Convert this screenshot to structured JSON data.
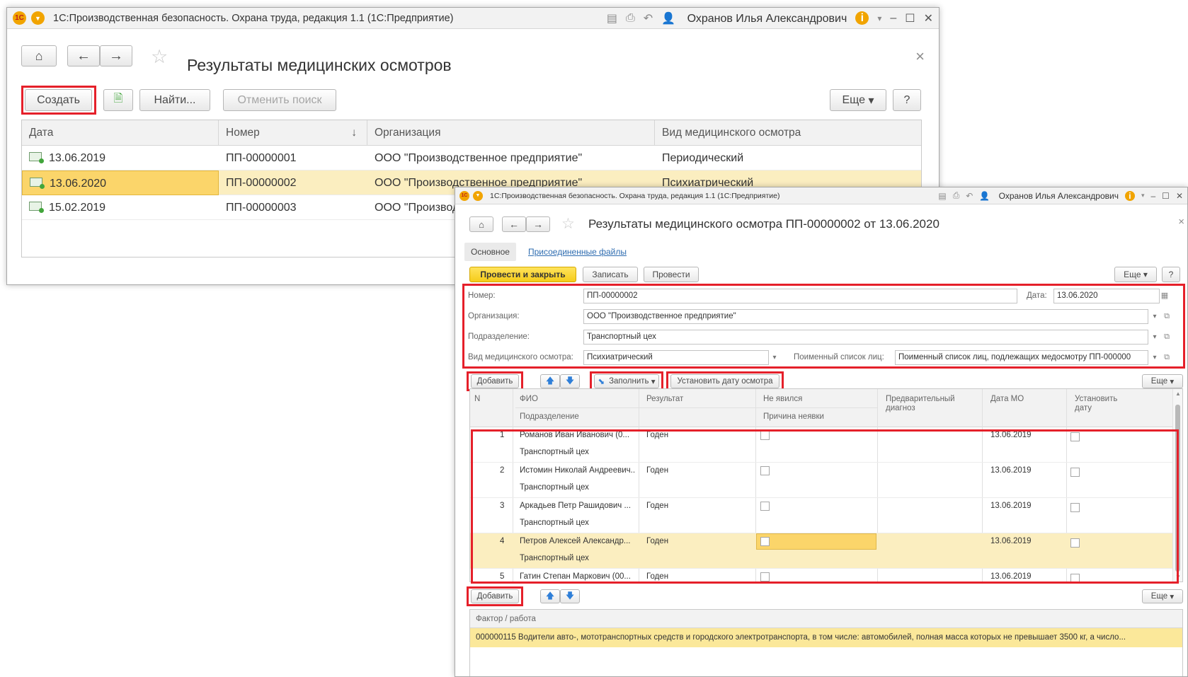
{
  "list_window": {
    "titlebar": {
      "title": "1С:Производственная безопасность. Охрана труда, редакция 1.1  (1С:Предприятие)",
      "user": "Охранов Илья Александрович",
      "logo": "1С"
    },
    "page_title": "Результаты медицинских осмотров",
    "toolbar": {
      "create": "Создать",
      "find": "Найти...",
      "cancel_search": "Отменить поиск",
      "more": "Еще",
      "help": "?"
    },
    "table": {
      "columns": [
        "Дата",
        "Номер",
        "Организация",
        "Вид медицинского осмотра"
      ],
      "sort_icon": "↓",
      "rows": [
        {
          "date": "13.06.2019",
          "number": "ПП-00000001",
          "org": "ООО \"Производственное предприятие\"",
          "kind": "Периодический"
        },
        {
          "date": "13.06.2020",
          "number": "ПП-00000002",
          "org": "ООО \"Производственное предприятие\"",
          "kind": "Психиатрический"
        },
        {
          "date": "15.02.2019",
          "number": "ПП-00000003",
          "org": "ООО \"Производственное предприятие\"",
          "kind": ""
        }
      ]
    }
  },
  "doc_window": {
    "titlebar": {
      "title": "1С:Производственная безопасность. Охрана труда, редакция 1.1  (1С:Предприятие)",
      "user": "Охранов Илья Александрович",
      "logo": "1С"
    },
    "page_title": "Результаты медицинского осмотра ПП-00000002 от 13.06.2020",
    "tabs": {
      "main": "Основное",
      "files": "Присоединенные файлы"
    },
    "toolbar": {
      "post_close": "Провести и закрыть",
      "save": "Записать",
      "post": "Провести",
      "more": "Еще",
      "help": "?"
    },
    "form": {
      "number_label": "Номер:",
      "number": "ПП-00000002",
      "date_label": "Дата:",
      "date": "13.06.2020",
      "org_label": "Организация:",
      "org": "ООО \"Производственное предприятие\"",
      "dept_label": "Подразделение:",
      "dept": "Транспортный цех",
      "kind_label": "Вид медицинского осмотра:",
      "kind": "Психиатрический",
      "list_label": "Поименный список лиц:",
      "list": "Поименный список лиц, подлежащих медосмотру ПП-000000"
    },
    "table_toolbar": {
      "add": "Добавить",
      "fill": "Заполнить",
      "set_date": "Установить дату осмотра",
      "more": "Еще"
    },
    "table": {
      "headers": {
        "n": "N",
        "fio": "ФИО",
        "dept": "Подразделение",
        "result": "Результат",
        "absent": "Не явился",
        "reason": "Причина неявки",
        "diagnosis": "Предварительный диагноз",
        "date_mo": "Дата МО",
        "set_date": "Установить дату"
      },
      "rows": [
        {
          "n": "1",
          "fio": "Романов Иван Иванович (0...",
          "dept": "Транспортный цех",
          "result": "Годен",
          "date_mo": "13.06.2019"
        },
        {
          "n": "2",
          "fio": "Истомин Николай Андреевич...",
          "dept": "Транспортный цех",
          "result": "Годен",
          "date_mo": "13.06.2019"
        },
        {
          "n": "3",
          "fio": "Аркадьев Петр Рашидович ...",
          "dept": "Транспортный цех",
          "result": "Годен",
          "date_mo": "13.06.2019"
        },
        {
          "n": "4",
          "fio": "Петров Алексей Александр...",
          "dept": "Транспортный цех",
          "result": "Годен",
          "date_mo": "13.06.2019"
        },
        {
          "n": "5",
          "fio": "Гатин Степан Маркович (00...",
          "dept": "",
          "result": "Годен",
          "date_mo": "13.06.2019"
        }
      ]
    },
    "factor_toolbar": {
      "add": "Добавить",
      "more": "Еще"
    },
    "factor_table": {
      "header": "Фактор / работа",
      "row": "000000115 Водители авто-, мототранспортных средств и городского электротранспорта, в том числе: автомобилей, полная масса которых не превышает 3500 кг, а число..."
    }
  },
  "icons": {
    "home": "⌂",
    "back": "←",
    "forward": "→",
    "star": "☆",
    "close": "×",
    "dropdown": "▾",
    "calendar": "▦",
    "open": "⧉",
    "up": "🡅",
    "down": "🡇",
    "fill": "⬊"
  },
  "colors": {
    "highlight_red": "#e5202a",
    "selection": "#fbeec0",
    "accent_yellow": "#f5cc1a",
    "brand_orange": "#f1a400"
  }
}
